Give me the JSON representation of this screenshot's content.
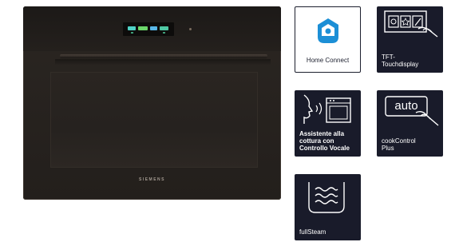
{
  "oven": {
    "brand_text": "SIEMENS",
    "display_colors": [
      "#4fd1c5",
      "#6bd66a",
      "#58b7e8",
      "#4ec7a3"
    ]
  },
  "features": {
    "home_connect": {
      "label": "Home Connect",
      "icon": "home-connect-icon",
      "accent": "#1c8fd6"
    },
    "tft": {
      "label_line1": "TFT-",
      "label_line2": "Touchdisplay",
      "icon": "touch-display-icon"
    },
    "voice": {
      "label_line1": "Assistente alla",
      "label_line2": "cottura con",
      "label_line3": "Controllo Vocale",
      "icon": "voice-control-icon"
    },
    "cook_control": {
      "badge": "auto",
      "label_line1": "cookControl",
      "label_line2": "Plus",
      "icon": "cook-control-icon"
    },
    "full_steam": {
      "label": "fullSteam",
      "icon": "steam-icon"
    }
  },
  "colors": {
    "tile_dark": "#191b2a",
    "tile_text": "#ffffff"
  }
}
